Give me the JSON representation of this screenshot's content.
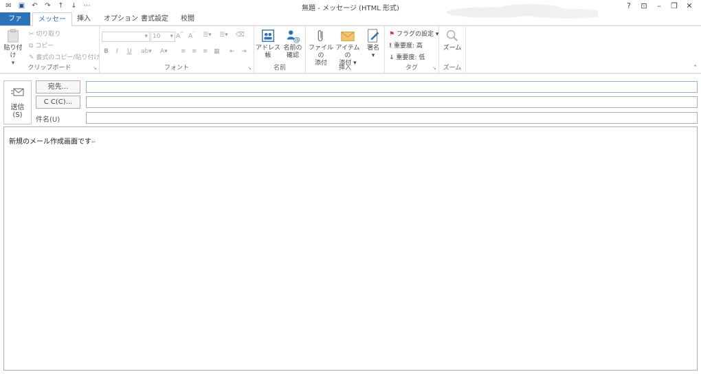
{
  "window": {
    "title": "無題 - メッセージ (HTML 形式)",
    "controls": [
      "?",
      "⊡",
      "–",
      "❐",
      "✕"
    ]
  },
  "tabs": [
    {
      "label": "ファイル"
    },
    {
      "label": "メッセージ"
    },
    {
      "label": "挿入"
    },
    {
      "label": "オプション"
    },
    {
      "label": "書式設定"
    },
    {
      "label": "校閲"
    }
  ],
  "ribbon": {
    "clipboard": {
      "label": "クリップボード",
      "paste": "貼り付け",
      "cut": "切り取り",
      "copy": "コピー",
      "format_painter": "書式のコピー/貼り付け"
    },
    "font": {
      "label": "フォント",
      "font_size": "10",
      "bold": "B",
      "italic": "I",
      "underline": "U"
    },
    "names": {
      "label": "名前",
      "address_book": "アドレス帳",
      "check_names_1": "名前の",
      "check_names_2": "確認"
    },
    "insert": {
      "label": "挿入",
      "attach_file_1": "ファイルの",
      "attach_file_2": "添付",
      "attach_item_1": "アイテムの",
      "attach_item_2": "添付",
      "signature": "署名"
    },
    "tags": {
      "label": "タグ",
      "followup": "フラグの設定",
      "high_importance": "重要度: 高",
      "low_importance": "重要度: 低"
    },
    "zoom": {
      "label": "ズーム",
      "zoom": "ズーム"
    }
  },
  "header": {
    "send_1": "送信",
    "send_2": "(S)",
    "to_button": "宛先...",
    "cc_button": "C C(C)...",
    "subject_label": "件名(U)",
    "to_value": "",
    "cc_value": "",
    "subject_value": ""
  },
  "body": {
    "text": "新規のメール作成画面です"
  }
}
